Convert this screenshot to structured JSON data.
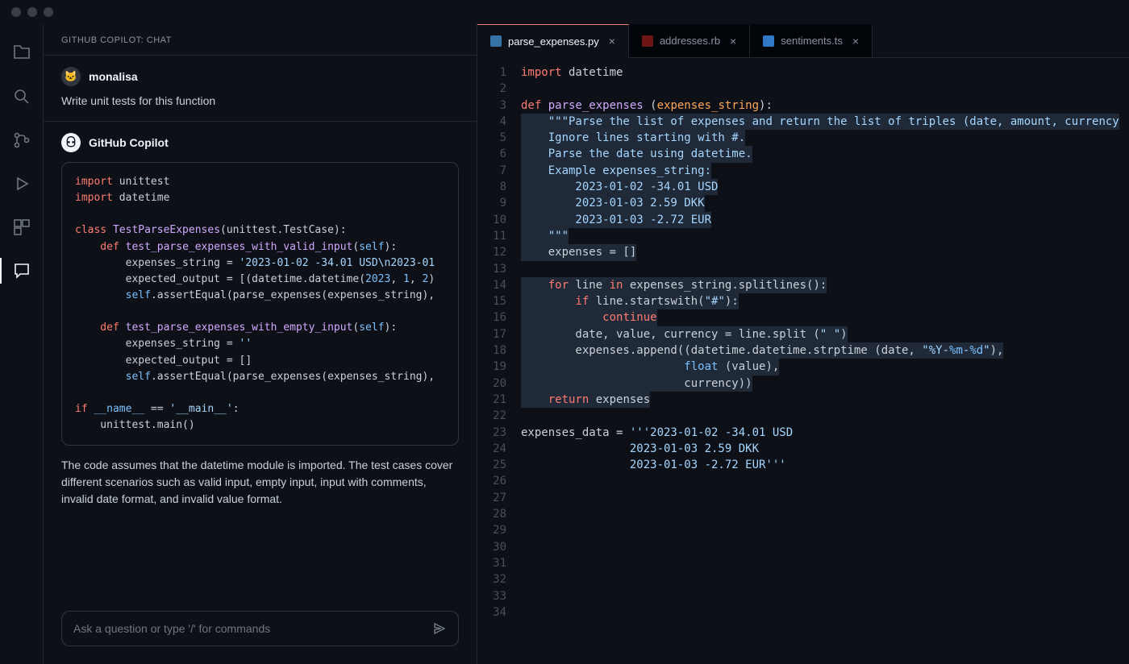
{
  "chat": {
    "header": "GITHUB COPILOT: CHAT",
    "user_name": "monalisa",
    "user_prompt": "Write unit tests for this function",
    "bot_name": "GitHub Copilot",
    "explanation": "The code assumes that the datetime module is imported. The test cases cover different scenarios such as valid input, empty input, input with comments, invalid date format, and invalid value format.",
    "input_placeholder": "Ask a question or type '/' for commands",
    "code": {
      "l1a": "import",
      "l1b": " unittest",
      "l2a": "import",
      "l2b": " datetime",
      "l3a": "class ",
      "l3b": "TestParseExpenses",
      "l3c": "(unittest.TestCase):",
      "l4a": "    def ",
      "l4b": "test_parse_expenses_with_valid_input",
      "l4c": "(",
      "l4d": "self",
      "l4e": "):",
      "l5a": "        expenses_string = ",
      "l5b": "'2023-01-02 -34.01 USD\\n2023-01",
      "l6a": "        expected_output = [(datetime.datetime(",
      "l6b": "2023",
      "l6c": ", ",
      "l6d": "1",
      "l6e": ", ",
      "l6f": "2",
      "l6g": ")",
      "l7a": "        ",
      "l7b": "self",
      "l7c": ".assertEqual(parse_expenses(expenses_string),",
      "l8a": "    def ",
      "l8b": "test_parse_expenses_with_empty_input",
      "l8c": "(",
      "l8d": "self",
      "l8e": "):",
      "l9a": "        expenses_string = ",
      "l9b": "''",
      "l10a": "        expected_output = []",
      "l11a": "        ",
      "l11b": "self",
      "l11c": ".assertEqual(parse_expenses(expenses_string),",
      "l12a": "if ",
      "l12b": "__name__",
      "l12c": " == ",
      "l12d": "'__main__'",
      "l12e": ":",
      "l13a": "    unittest.main()"
    }
  },
  "tabs": [
    {
      "label": "parse_expenses.py",
      "active": true,
      "color": "#3572A5"
    },
    {
      "label": "addresses.rb",
      "active": false,
      "color": "#701516"
    },
    {
      "label": "sentiments.ts",
      "active": false,
      "color": "#3178c6"
    }
  ],
  "editor": {
    "line_count": 34,
    "lines": {
      "1": {
        "t": [
          [
            "kw",
            "import"
          ],
          [
            "dull",
            " datetime"
          ]
        ]
      },
      "2": {
        "t": []
      },
      "3": {
        "t": [
          [
            "kw",
            "def "
          ],
          [
            "fn",
            "parse_expenses"
          ],
          [
            "dull",
            " ("
          ],
          [
            "param",
            "expenses_string"
          ],
          [
            "dull",
            "):"
          ]
        ]
      },
      "4": {
        "hl": true,
        "t": [
          [
            "dull",
            "    "
          ],
          [
            "st",
            "\"\"\"Parse the list of expenses and return the list of triples (date, amount, currency"
          ]
        ]
      },
      "5": {
        "hl": true,
        "t": [
          [
            "dull",
            "    "
          ],
          [
            "st",
            "Ignore lines starting with #."
          ]
        ]
      },
      "6": {
        "hl": true,
        "t": [
          [
            "dull",
            "    "
          ],
          [
            "st",
            "Parse the date using datetime."
          ]
        ]
      },
      "7": {
        "hl": true,
        "t": [
          [
            "dull",
            "    "
          ],
          [
            "st",
            "Example expenses_string:"
          ]
        ]
      },
      "8": {
        "hl": true,
        "t": [
          [
            "dull",
            "    "
          ],
          [
            "st",
            "    2023-01-02 -34.01 USD"
          ]
        ]
      },
      "9": {
        "hl": true,
        "t": [
          [
            "dull",
            "    "
          ],
          [
            "st",
            "    2023-01-03 2.59 DKK"
          ]
        ]
      },
      "10": {
        "hl": true,
        "t": [
          [
            "dull",
            "    "
          ],
          [
            "st",
            "    2023-01-03 -2.72 EUR"
          ]
        ]
      },
      "11": {
        "hl": true,
        "t": [
          [
            "dull",
            "    "
          ],
          [
            "st",
            "\"\"\""
          ]
        ]
      },
      "12": {
        "hl": true,
        "t": [
          [
            "dull",
            "    expenses = []"
          ]
        ]
      },
      "13": {
        "hl": true,
        "t": []
      },
      "14": {
        "hl": true,
        "t": [
          [
            "dull",
            "    "
          ],
          [
            "kw",
            "for"
          ],
          [
            "dull",
            " line "
          ],
          [
            "kw",
            "in"
          ],
          [
            "dull",
            " expenses_string.splitlines():"
          ]
        ]
      },
      "15": {
        "hl": true,
        "t": [
          [
            "dull",
            "        "
          ],
          [
            "kw",
            "if"
          ],
          [
            "dull",
            " line.startswith("
          ],
          [
            "st",
            "\"#\""
          ],
          [
            "dull",
            "):"
          ]
        ]
      },
      "16": {
        "hl": true,
        "t": [
          [
            "dull",
            "            "
          ],
          [
            "kw",
            "continue"
          ]
        ]
      },
      "17": {
        "hl": true,
        "t": [
          [
            "dull",
            "        date, value, currency = line.split ("
          ],
          [
            "st",
            "\" \""
          ],
          [
            "dull",
            ")"
          ]
        ]
      },
      "18": {
        "hl": true,
        "t": [
          [
            "dull",
            "        expenses.append((datetime.datetime.strptime (date, "
          ],
          [
            "st",
            "\"%Y-"
          ],
          [
            "bi",
            "%m"
          ],
          [
            "st",
            "-"
          ],
          [
            "bi",
            "%d"
          ],
          [
            "st",
            "\""
          ],
          [
            "dull",
            "),"
          ]
        ]
      },
      "19": {
        "hl": true,
        "t": [
          [
            "dull",
            "                        "
          ],
          [
            "bi",
            "float"
          ],
          [
            "dull",
            " (value),"
          ]
        ]
      },
      "20": {
        "hl": true,
        "t": [
          [
            "dull",
            "                        currency))"
          ]
        ]
      },
      "21": {
        "hl": true,
        "t": [
          [
            "dull",
            "    "
          ],
          [
            "kw",
            "return"
          ],
          [
            "dull",
            " expenses"
          ]
        ]
      },
      "22": {
        "t": []
      },
      "23": {
        "t": [
          [
            "dull",
            "expenses_data = "
          ],
          [
            "st",
            "'''2023-01-02 -34.01 USD"
          ]
        ]
      },
      "24": {
        "t": [
          [
            "dull",
            "                "
          ],
          [
            "st",
            "2023-01-03 2.59 DKK"
          ]
        ]
      },
      "25": {
        "t": [
          [
            "dull",
            "                "
          ],
          [
            "st",
            "2023-01-03 -2.72 EUR'''"
          ]
        ]
      },
      "26": {
        "t": []
      },
      "27": {
        "t": []
      },
      "28": {
        "t": []
      },
      "29": {
        "t": []
      },
      "30": {
        "t": []
      },
      "31": {
        "t": []
      },
      "32": {
        "t": []
      },
      "33": {
        "t": []
      },
      "34": {
        "t": []
      }
    }
  }
}
